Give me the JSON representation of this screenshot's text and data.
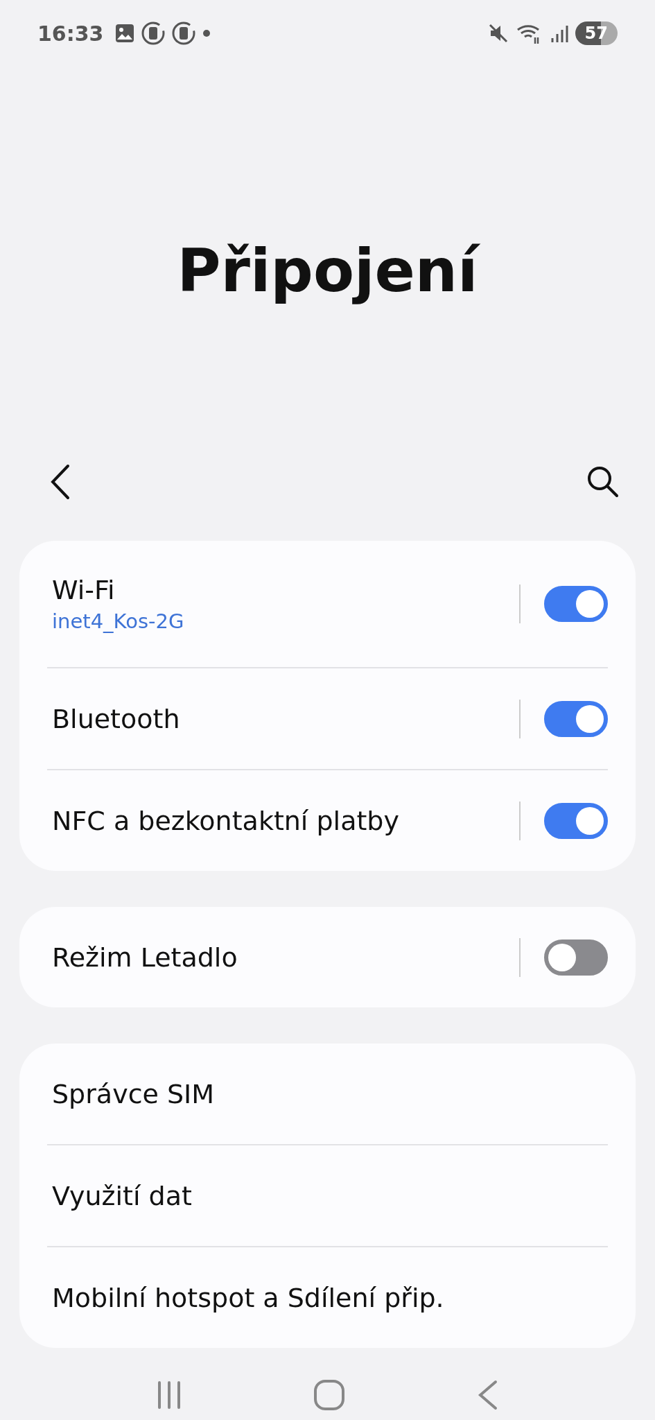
{
  "status_bar": {
    "time": "16:33",
    "battery": "57"
  },
  "title": "Připojení",
  "groups": [
    {
      "items": [
        {
          "label": "Wi-Fi",
          "subtitle": "inet4_Kos-2G",
          "kind": "toggle",
          "on": true
        },
        {
          "label": "Bluetooth",
          "kind": "toggle",
          "on": true
        },
        {
          "label": "NFC a bezkontaktní platby",
          "kind": "toggle",
          "on": true
        }
      ]
    },
    {
      "items": [
        {
          "label": "Režim Letadlo",
          "kind": "toggle",
          "on": false
        }
      ]
    },
    {
      "items": [
        {
          "label": "Správce SIM",
          "kind": "link"
        },
        {
          "label": "Využití dat",
          "kind": "link"
        },
        {
          "label": "Mobilní hotspot a Sdílení přip.",
          "kind": "link"
        }
      ]
    }
  ]
}
